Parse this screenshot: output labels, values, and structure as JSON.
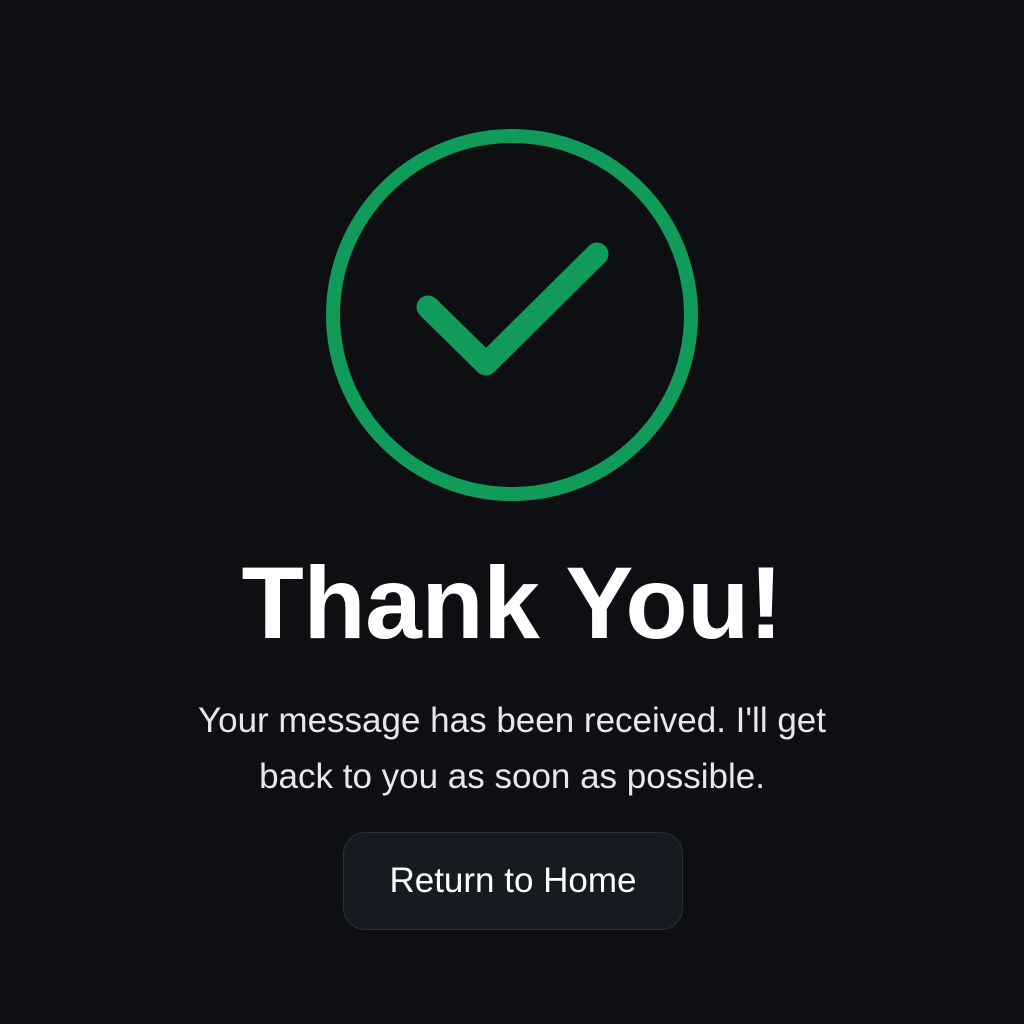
{
  "confirmation": {
    "icon": "check-circle-icon",
    "accent_color": "#109b5a",
    "title": "Thank You!",
    "message": "Your message has been received. I'll get back to you as soon as possible.",
    "return_button_label": "Return to Home"
  }
}
